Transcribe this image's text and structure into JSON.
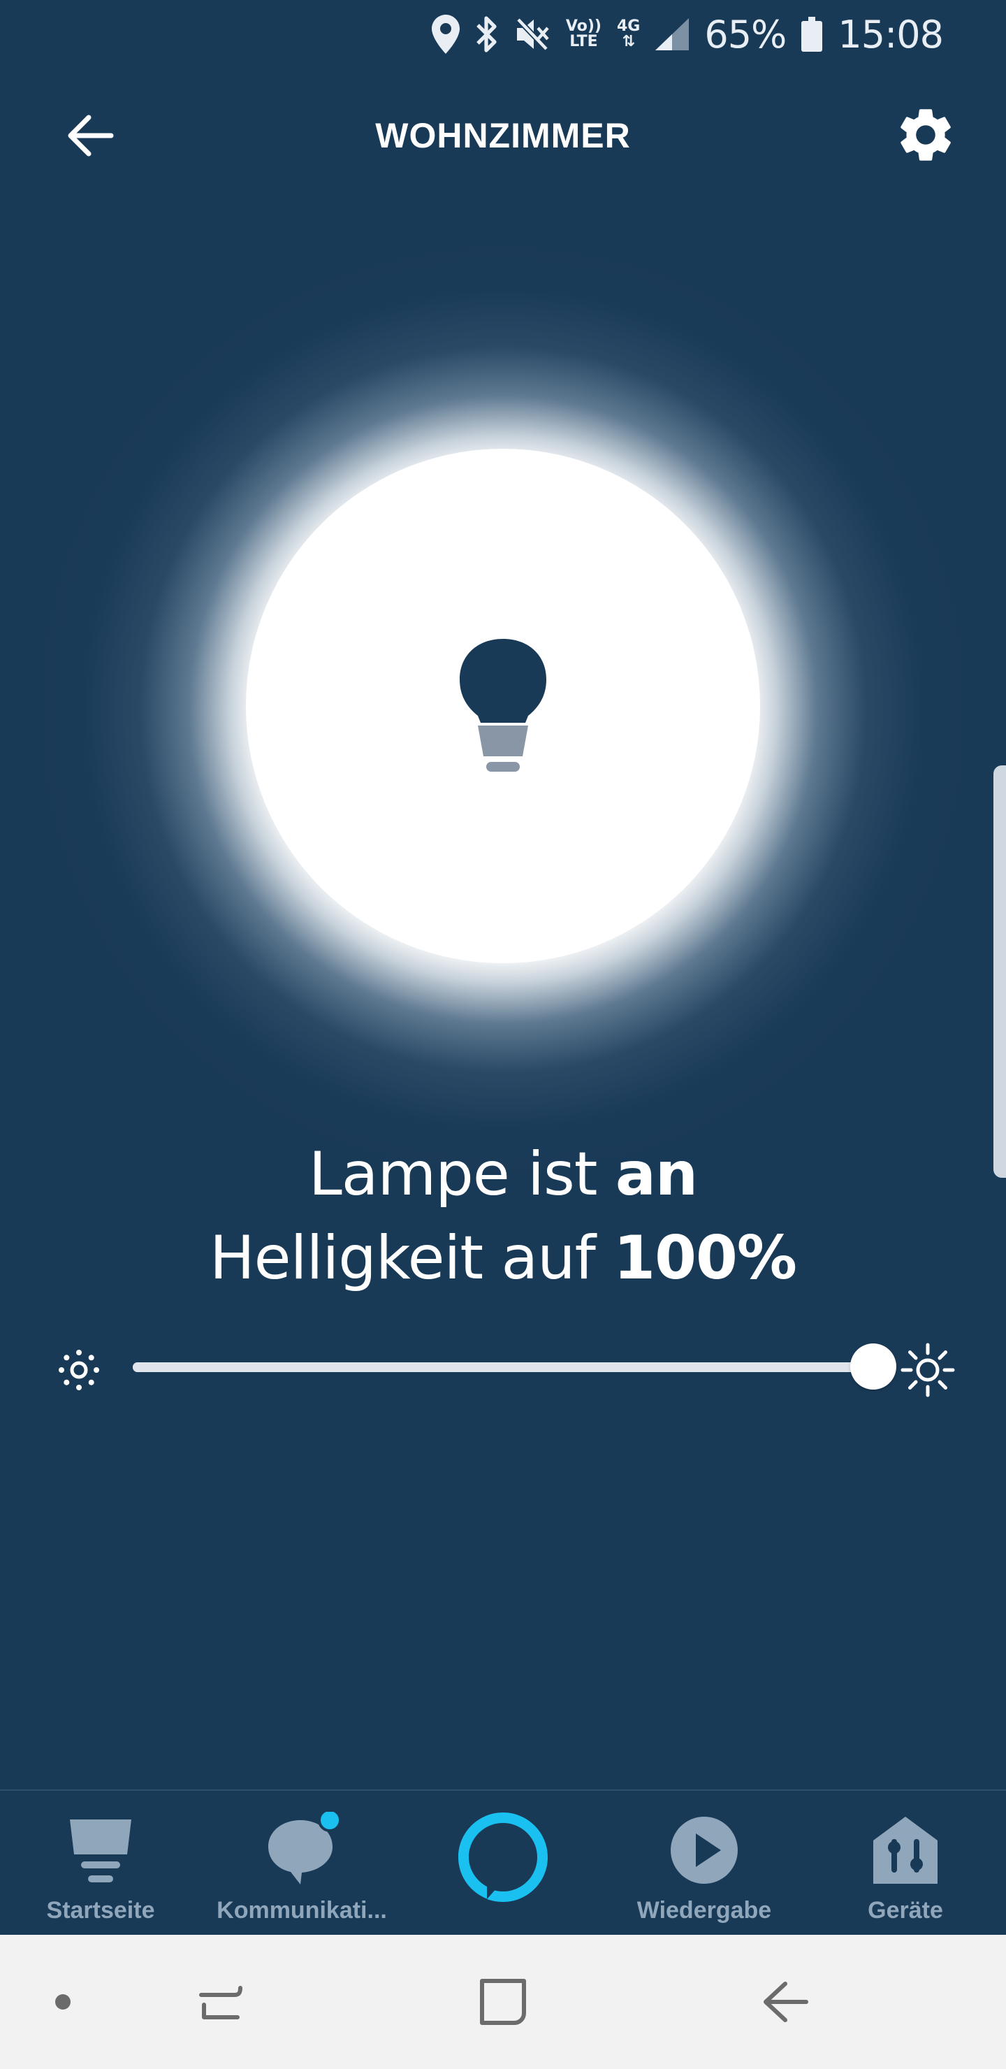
{
  "status_bar": {
    "volte_top": "Vo))",
    "volte_bottom": "LTE",
    "network": "4G",
    "battery": "65%",
    "time": "15:08"
  },
  "header": {
    "title": "WOHNZIMMER"
  },
  "lamp": {
    "line1_prefix": "Lampe ist ",
    "line1_state": "an",
    "line2_prefix": "Helligkeit auf ",
    "line2_value": "100%",
    "brightness_fraction": 1.0
  },
  "colors": {
    "background": "#193a57",
    "bulb": "#193a57",
    "bulb_base": "#8896a6",
    "nav_inactive": "#8fa6bb",
    "alexa_ring": "#19c0f0",
    "notification_dot": "#19c0f0"
  },
  "bottom_nav": {
    "items": [
      {
        "label": "Startseite",
        "icon": "home-icon"
      },
      {
        "label": "Kommunikati...",
        "icon": "chat-icon"
      },
      {
        "label": "",
        "icon": "alexa-icon"
      },
      {
        "label": "Wiedergabe",
        "icon": "play-icon"
      },
      {
        "label": "Geräte",
        "icon": "devices-icon"
      }
    ]
  }
}
